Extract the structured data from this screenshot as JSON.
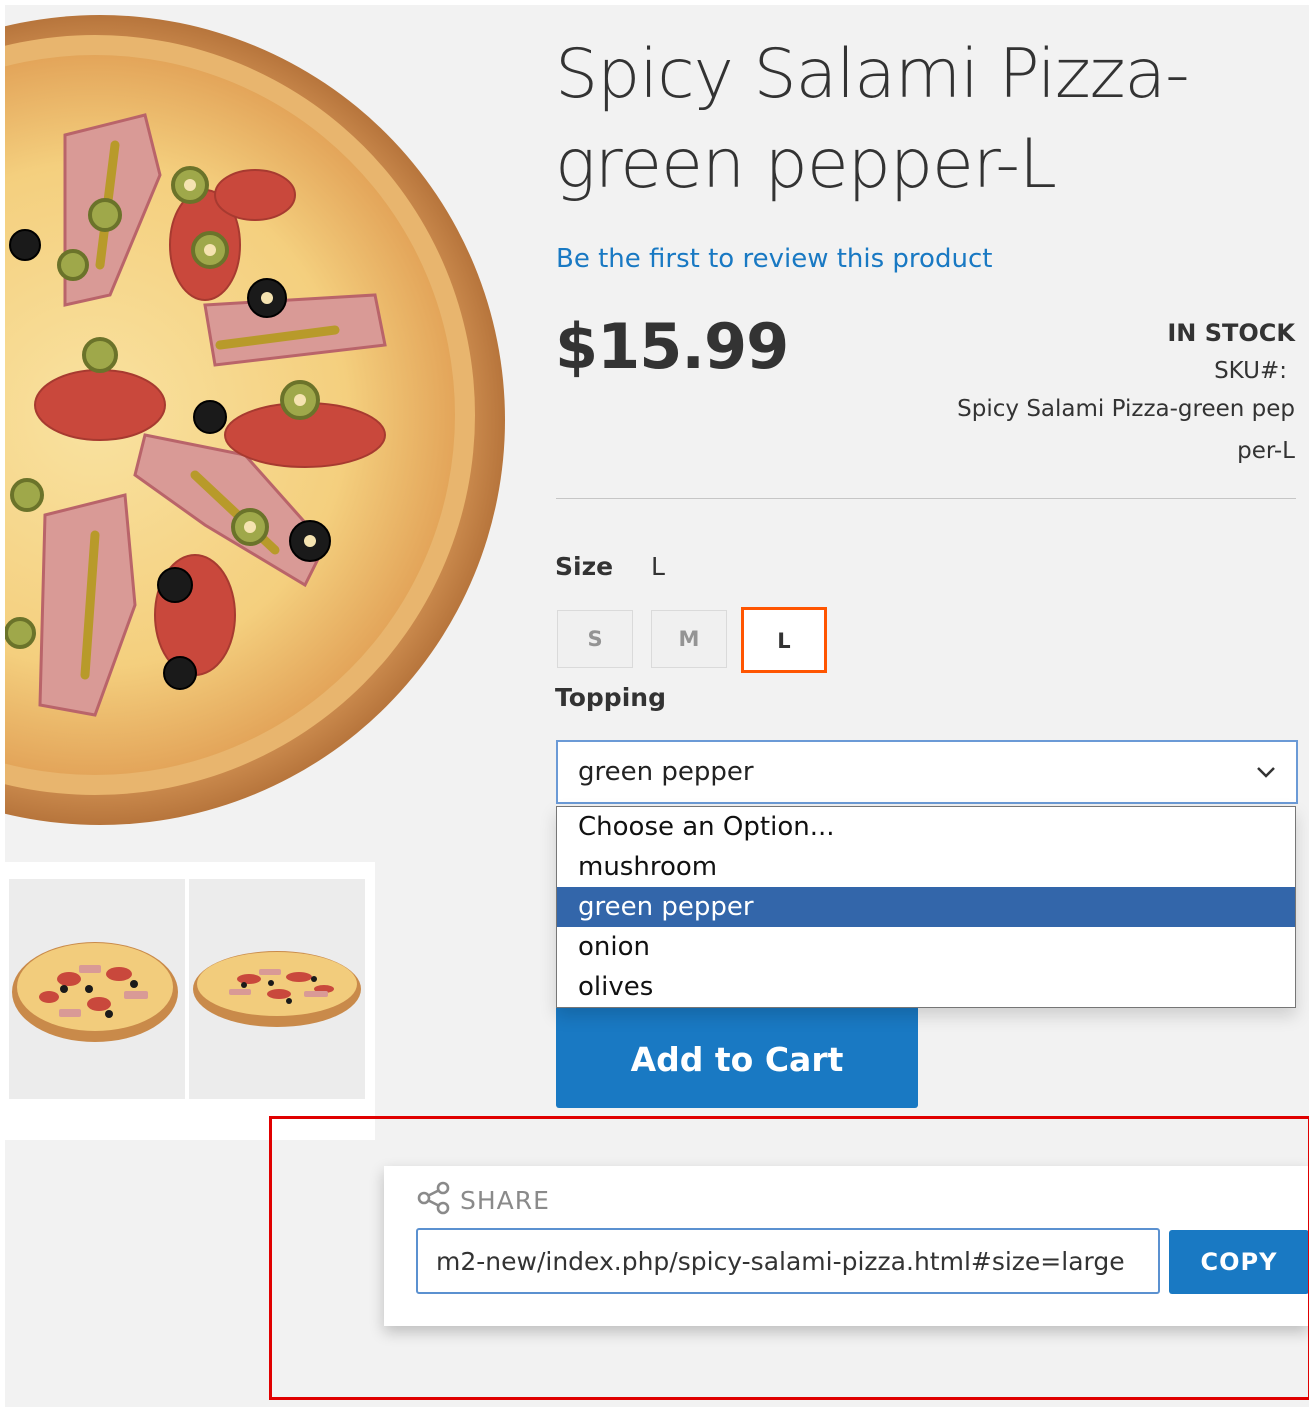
{
  "product": {
    "title": "Spicy Salami Pizza-green pepper-L",
    "review_link": "Be the first to review this product",
    "price": "$15.99",
    "stock_status": "IN STOCK",
    "sku_label": "SKU#:",
    "sku_value": "Spicy Salami Pizza-green pepper-L"
  },
  "size": {
    "label": "Size",
    "selected": "L",
    "options": [
      "S",
      "M",
      "L"
    ]
  },
  "topping": {
    "label": "Topping",
    "selected": "green pepper",
    "options": [
      "Choose an Option...",
      "mushroom",
      "green pepper",
      "onion",
      "olives"
    ]
  },
  "actions": {
    "add_to_cart": "Add to Cart"
  },
  "share": {
    "title": "SHARE",
    "url": "m2-new/index.php/spicy-salami-pizza.html#size=large",
    "copy_label": "COPY"
  },
  "colors": {
    "accent_blue": "#1979c3",
    "selected_swatch_border": "#ff5501",
    "dropdown_highlight": "#3366aa",
    "annotation_box": "#e00000"
  },
  "icons": {
    "share": "share-icon",
    "dropdown": "chevron-down-icon"
  }
}
